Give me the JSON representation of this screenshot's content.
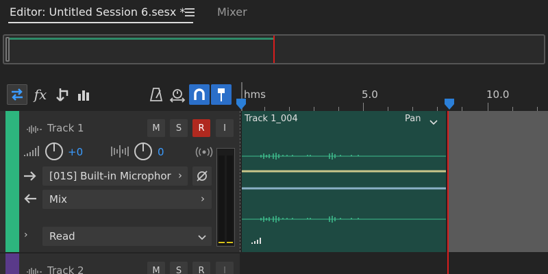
{
  "tabs": {
    "editor_title": "Editor: Untitled Session 6.sesx *",
    "mixer_label": "Mixer"
  },
  "ruler": {
    "unit_label": "hms",
    "ticks": [
      "5.0",
      "10.0"
    ]
  },
  "track1": {
    "name": "Track 1",
    "mute_label": "M",
    "solo_label": "S",
    "record_label": "R",
    "input_label": "I",
    "volume_value": "+0",
    "pan_value": "0",
    "input_device": "[01S] Built-in Microphor",
    "output": "Mix",
    "automation_mode": "Read"
  },
  "clip": {
    "name": "Track 1_004",
    "param": "Pan"
  },
  "track2": {
    "name": "Track 2",
    "mute_label": "M",
    "solo_label": "S",
    "record_label": "R",
    "input_label": "I"
  },
  "colors": {
    "track1_accent": "#2db57e",
    "track2_accent": "#5a3a8a",
    "record_active": "#b0291f",
    "playhead": "#d81e1e",
    "marker_blue": "#2b7fd8",
    "clip_bg": "#1e4a42",
    "waveform": "#3fbf8e"
  }
}
